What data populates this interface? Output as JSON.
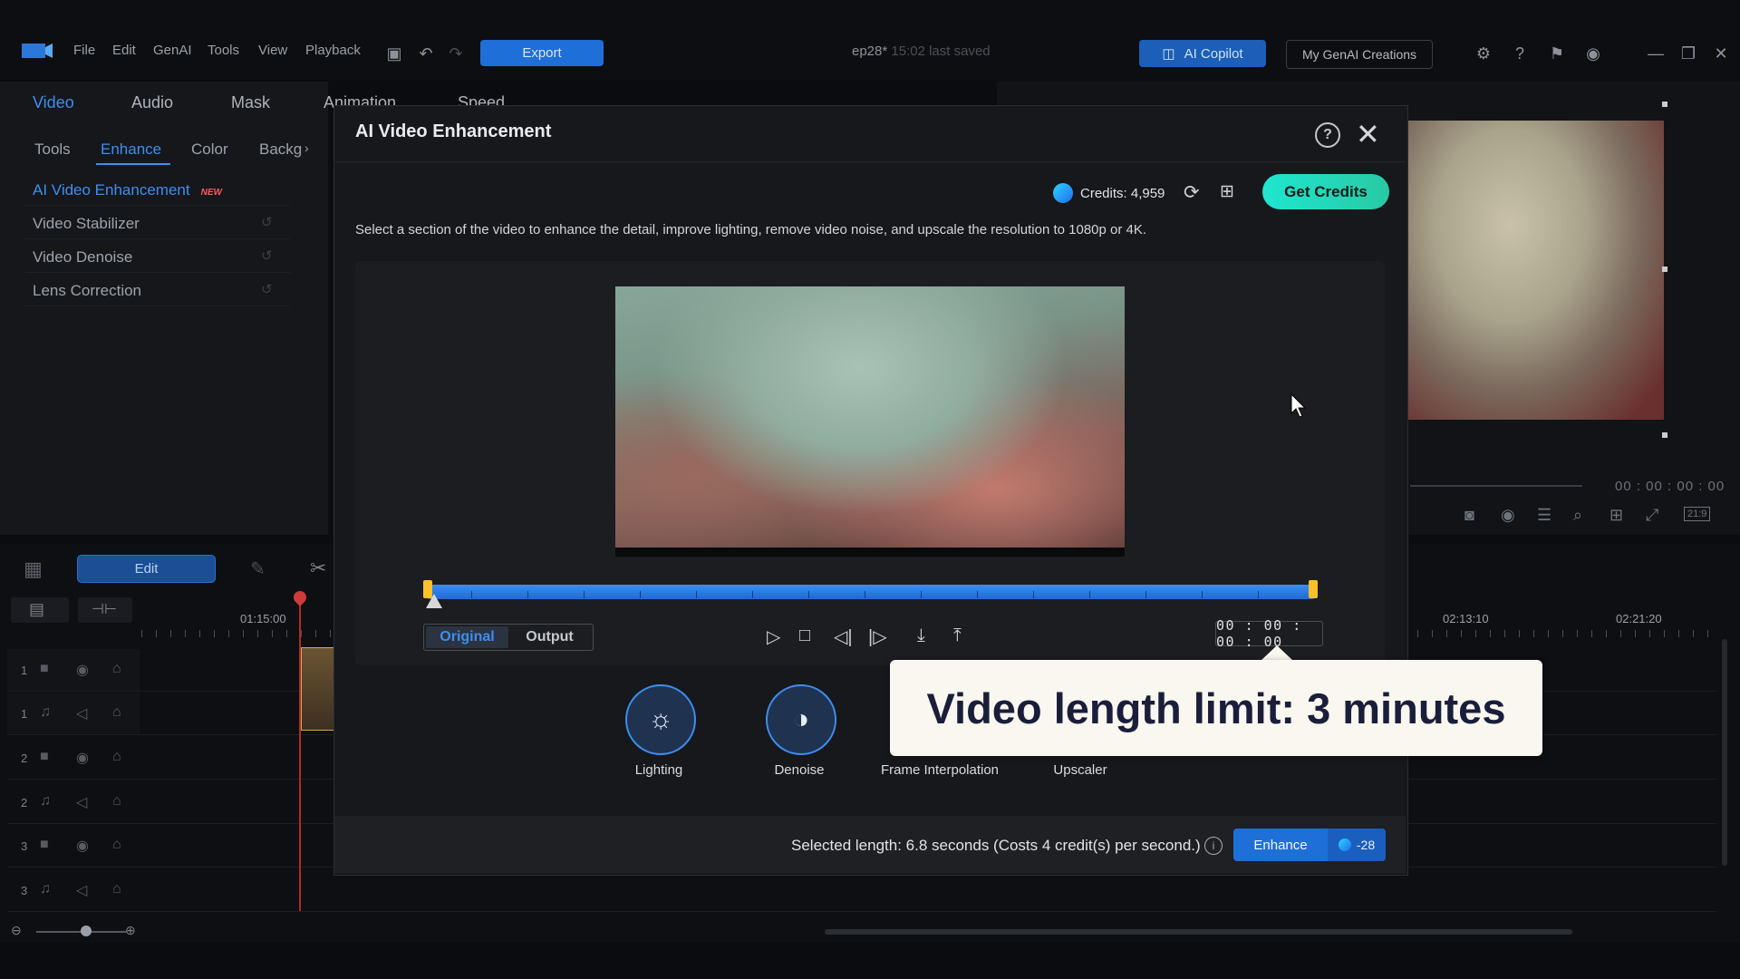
{
  "app": {
    "menu": [
      "File",
      "Edit",
      "GenAI",
      "Tools",
      "View",
      "Playback"
    ],
    "export_label": "Export",
    "project_name": "ep28*",
    "project_saved": "15:02 last saved",
    "copilot_label": "AI Copilot",
    "my_genai_label": "My GenAI Creations"
  },
  "left_panel": {
    "main_tabs": [
      "Video",
      "Audio",
      "Mask",
      "Animation",
      "Speed"
    ],
    "sub_tabs": [
      "Tools",
      "Enhance",
      "Color",
      "Backg"
    ],
    "features": [
      {
        "label": "AI Video Enhancement",
        "badge": "NEW"
      },
      {
        "label": "Video Stabilizer"
      },
      {
        "label": "Video Denoise"
      },
      {
        "label": "Lens Correction"
      }
    ]
  },
  "preview": {
    "timecode": "00 : 00 : 00 : 00",
    "aspect": "21:9"
  },
  "timeline": {
    "edit_label": "Edit",
    "ruler": [
      "01:15:00",
      "02:13:10",
      "02:21:20"
    ],
    "tracks": [
      {
        "num": "1",
        "kind": "video"
      },
      {
        "num": "1",
        "kind": "audio"
      },
      {
        "num": "2",
        "kind": "video"
      },
      {
        "num": "2",
        "kind": "audio"
      },
      {
        "num": "3",
        "kind": "video"
      },
      {
        "num": "3",
        "kind": "audio"
      }
    ]
  },
  "modal": {
    "title": "AI Video Enhancement",
    "credits": "Credits: 4,959",
    "get_credits_label": "Get Credits",
    "description": "Select a section of the video to enhance the detail, improve lighting, remove video noise, and upscale the resolution to 1080p or 4K.",
    "toggle": {
      "original": "Original",
      "output": "Output",
      "selected": "Original"
    },
    "timecode": "00 : 00 : 00 : 00",
    "features": [
      {
        "label": "Lighting",
        "icon": "bulb-icon"
      },
      {
        "label": "Denoise",
        "icon": "denoise-icon"
      },
      {
        "label": "Frame Interpolation",
        "icon": "frame-icon"
      },
      {
        "label": "Upscaler",
        "icon": "upscale-icon"
      }
    ],
    "selected_length": "Selected length: 6.8 seconds (Costs 4 credit(s) per second.)",
    "enhance_label": "Enhance",
    "enhance_cost": "-28"
  },
  "callout": {
    "text": "Video length limit: 3 minutes"
  },
  "colors": {
    "accent": "#3d8ef0",
    "get_credits": "#1fe6d0",
    "scrub_handle": "#ffc12a"
  }
}
